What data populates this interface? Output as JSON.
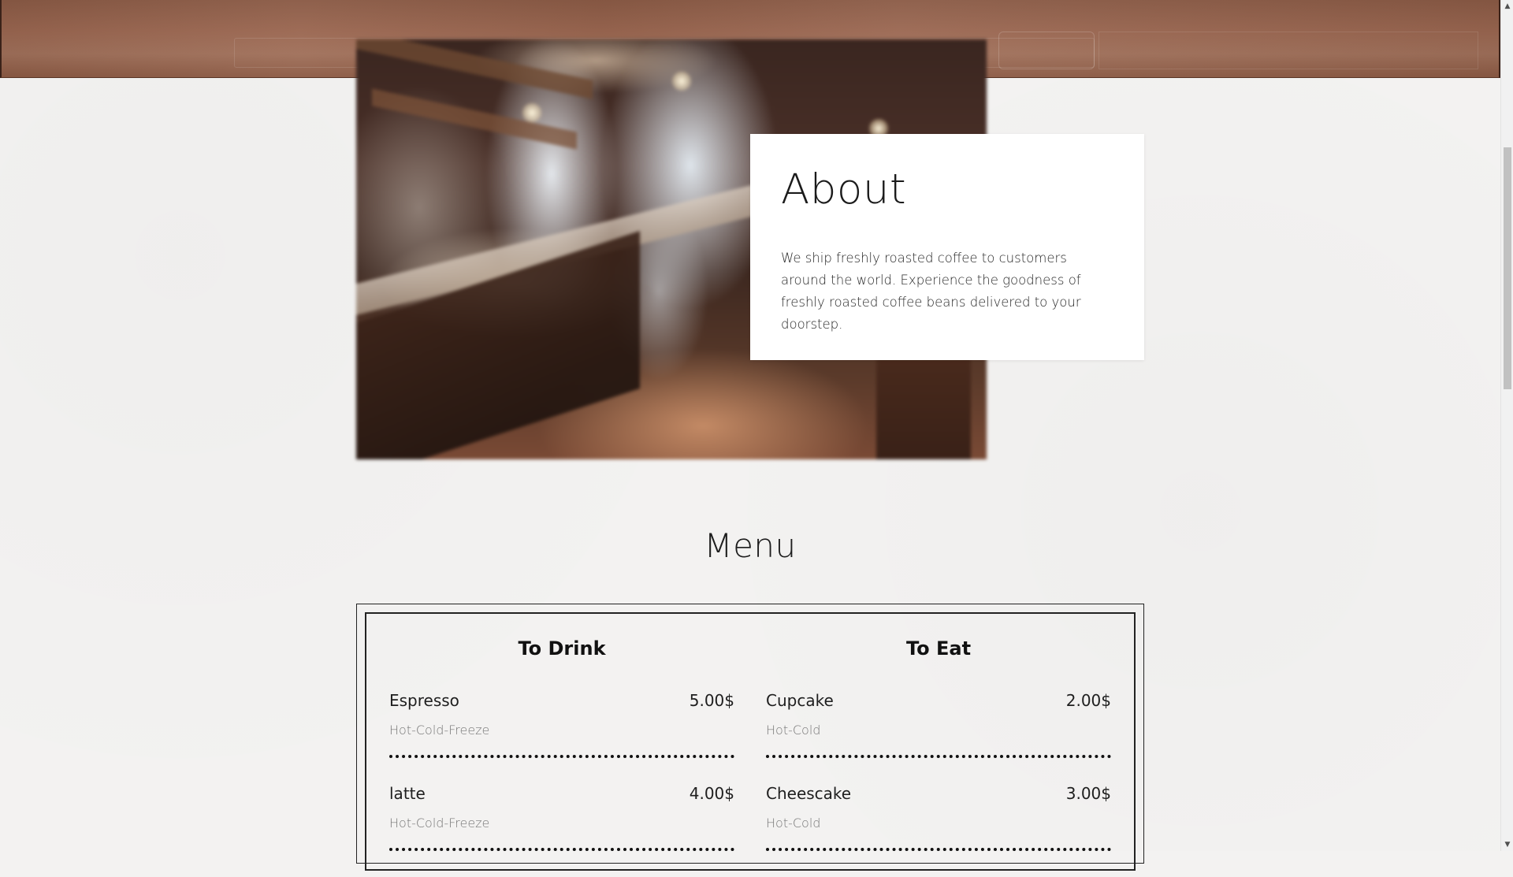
{
  "about": {
    "title": "About",
    "text": "We ship freshly roasted coffee to customers around the world. Experience the goodness of freshly roasted coffee beans delivered to your doorstep."
  },
  "menu": {
    "heading": "Menu",
    "drink": {
      "title": "To Drink",
      "items": [
        {
          "name": "Espresso",
          "price": "5.00$",
          "desc": "Hot-Cold-Freeze"
        },
        {
          "name": "latte",
          "price": "4.00$",
          "desc": "Hot-Cold-Freeze"
        }
      ]
    },
    "eat": {
      "title": "To Eat",
      "items": [
        {
          "name": "Cupcake",
          "price": "2.00$",
          "desc": "Hot-Cold"
        },
        {
          "name": "Cheescake",
          "price": "3.00$",
          "desc": "Hot-Cold"
        }
      ]
    }
  },
  "scrollbar": {
    "up_icon": "scroll-up-arrow-icon",
    "down_icon": "scroll-down-arrow-icon",
    "up_glyph": "▲",
    "down_glyph": "▼"
  },
  "colors": {
    "page_background": "#f3f2f1",
    "hero_brown": "#9a6650",
    "card_background": "#ffffff",
    "menu_border": "#222222"
  }
}
